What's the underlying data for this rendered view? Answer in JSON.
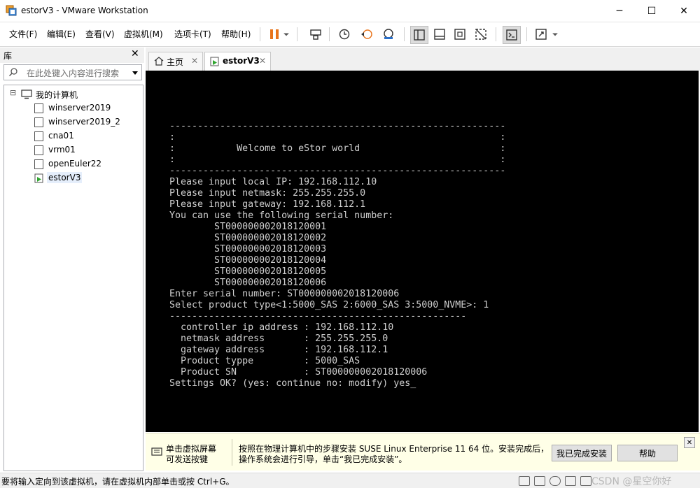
{
  "window": {
    "title": "estorV3 - VMware Workstation",
    "minimize_glyph": "─",
    "maximize_glyph": "☐",
    "close_glyph": "✕"
  },
  "menubar": {
    "items": [
      "文件(F)",
      "编辑(E)",
      "查看(V)",
      "虚拟机(M)",
      "选项卡(T)",
      "帮助(H)"
    ]
  },
  "library": {
    "title": "库",
    "close_glyph": "✕",
    "search_placeholder": "在此处键入内容进行搜索",
    "root_label": "我的计算机",
    "expand_glyph": "⊟",
    "vms": [
      "winserver2019",
      "winserver2019_2",
      "cna01",
      "vrm01",
      "openEuler22",
      "estorV3"
    ],
    "selected_vm": "estorV3"
  },
  "tabs": {
    "home_label": "主页",
    "vm_label": "estorV3",
    "close_glyph": "✕"
  },
  "console": {
    "text": "------------------------------------------------------------\n:                                                          :\n:           Welcome to eStor world                         :\n:                                                          :\n------------------------------------------------------------\nPlease input local IP: 192.168.112.10\nPlease input netmask: 255.255.255.0\nPlease input gateway: 192.168.112.1\nYou can use the following serial number:\n        ST000000002018120001\n        ST000000002018120002\n        ST000000002018120003\n        ST000000002018120004\n        ST000000002018120005\n        ST000000002018120006\nEnter serial number: ST000000002018120006\nSelect product type<1:5000_SAS 2:6000_SAS 3:5000_NVME>: 1\n\n  controller ip address : 192.168.112.10\n  netmask address       : 255.255.255.0\n  gateway address       : 192.168.112.1\n  Product typpe         : 5000_SAS\n  Product SN            : ST000000002018120006\nSettings OK? (yes: continue no: modify) yes_",
    "divider": "-----------------------------------------------------"
  },
  "hint": {
    "left_line1": "单击虚拟屏幕",
    "left_line2": "可发送按键",
    "msg_line1": "按照在物理计算机中的步骤安装 SUSE Linux Enterprise 11 64 位。安装完成后，",
    "msg_line2": "操作系统会进行引导，单击“我已完成安装”。",
    "done_button": "我已完成安装",
    "help_button": "帮助",
    "close_glyph": "✕"
  },
  "status": {
    "text": "要将输入定向到该虚拟机，请在虚拟机内部单击或按 Ctrl+G。",
    "watermark": "CSDN @星空你好"
  },
  "colors": {
    "console_bg": "#000000",
    "console_fg": "#cfcfcf",
    "hint_bg": "#ffffe7",
    "pause_orange": "#e8731a"
  }
}
